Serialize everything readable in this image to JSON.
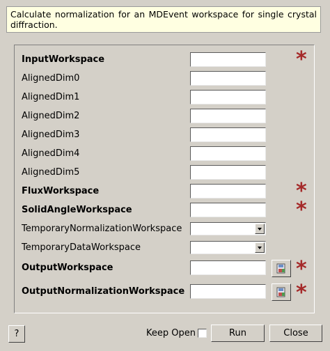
{
  "description": "Calculate normalization for an MDEvent workspace for single crystal diffraction.",
  "properties": [
    {
      "label": "InputWorkspace",
      "bold": true,
      "type": "text",
      "value": "",
      "required": true
    },
    {
      "label": "AlignedDim0",
      "bold": false,
      "type": "text",
      "value": "",
      "required": false
    },
    {
      "label": "AlignedDim1",
      "bold": false,
      "type": "text",
      "value": "",
      "required": false
    },
    {
      "label": "AlignedDim2",
      "bold": false,
      "type": "text",
      "value": "",
      "required": false
    },
    {
      "label": "AlignedDim3",
      "bold": false,
      "type": "text",
      "value": "",
      "required": false
    },
    {
      "label": "AlignedDim4",
      "bold": false,
      "type": "text",
      "value": "",
      "required": false
    },
    {
      "label": "AlignedDim5",
      "bold": false,
      "type": "text",
      "value": "",
      "required": false
    },
    {
      "label": "FluxWorkspace",
      "bold": true,
      "type": "text",
      "value": "",
      "required": true
    },
    {
      "label": "SolidAngleWorkspace",
      "bold": true,
      "type": "text",
      "value": "",
      "required": true
    },
    {
      "label": "TemporaryNormalizationWorkspace",
      "bold": false,
      "type": "combo",
      "value": "",
      "required": false
    },
    {
      "label": "TemporaryDataWorkspace",
      "bold": false,
      "type": "combo",
      "value": "",
      "required": false
    },
    {
      "label": "OutputWorkspace",
      "bold": true,
      "type": "text",
      "value": "",
      "required": true,
      "browse": true
    },
    {
      "label": "OutputNormalizationWorkspace",
      "bold": true,
      "type": "text",
      "value": "",
      "required": true,
      "browse": true
    }
  ],
  "required_marker": "*",
  "footer": {
    "help_label": "?",
    "keep_open_label": "Keep Open",
    "keep_open_checked": false,
    "run_label": "Run",
    "close_label": "Close"
  },
  "colors": {
    "background": "#d4d0c8",
    "description_bg": "#ffffe1",
    "required_star": "#a52a2a"
  },
  "icons": {
    "browse": "save-file-icon",
    "combo_arrow": "chevron-down-icon"
  }
}
